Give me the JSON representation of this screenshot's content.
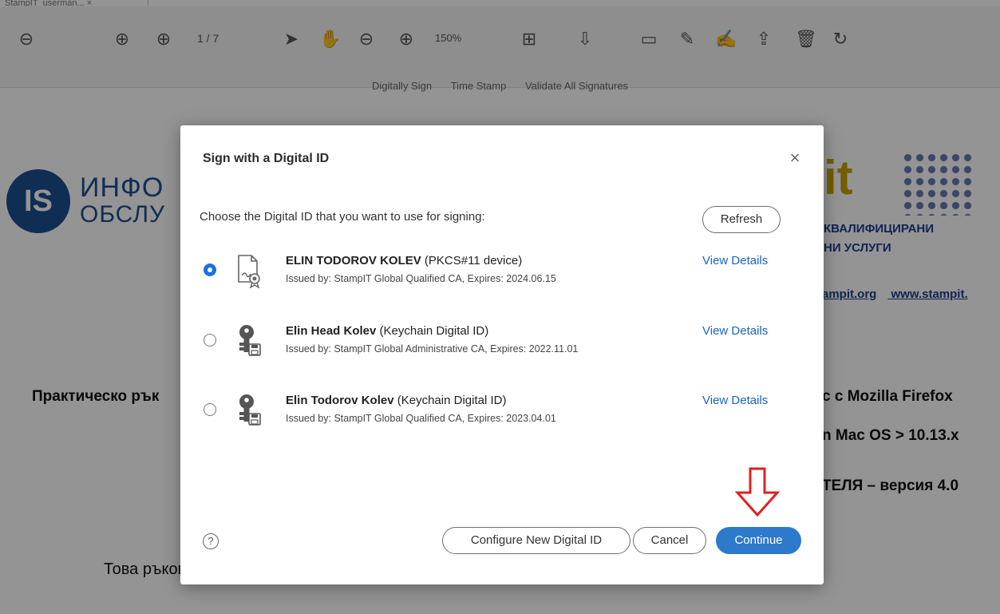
{
  "tab": {
    "label": "StampIT_userman... ×"
  },
  "toolbar": {
    "page_indicator": "1 / 7",
    "zoom_level": "150%",
    "sign_actions": [
      "Digitally Sign",
      "Time Stamp",
      "Validate All Signatures"
    ]
  },
  "document": {
    "logo_mark": "IS",
    "logo_line1": "ИНФО",
    "logo_line2": "ОБСЛУ",
    "brand_right": "it",
    "right_line1": "КВАЛИФИЦИРАНИ",
    "right_line2": "НИ УСЛУГИ",
    "right_links": [
      "ampit.org",
      "www.stampit."
    ],
    "heading_left": "Практическо рък",
    "heading_right_1": "с с Mozilla Firefox",
    "heading_right_2": "n Mac OS > 10.13.x",
    "heading_right_3": "ТЕЛЯ – версия 4.0",
    "paragraph": "Това ръководство е предназначено за потребители, притежаващи смарт карти, предоставени от"
  },
  "dialog": {
    "title": "Sign with a Digital ID",
    "close_glyph": "×",
    "prompt": "Choose the Digital ID that you want to use for signing:",
    "refresh_label": "Refresh",
    "view_details_label": "View Details",
    "ids": [
      {
        "name": "ELIN TODOROV KOLEV",
        "type": "(PKCS#11 device)",
        "issuer": "Issued by: StampIT Global Qualified CA, Expires: 2024.06.15",
        "selected": true,
        "icon": "certificate-icon"
      },
      {
        "name": "Elin Head Kolev",
        "type": "(Keychain Digital ID)",
        "issuer": "Issued by: StampIT Global Administrative CA, Expires: 2022.11.01",
        "selected": false,
        "icon": "key-icon"
      },
      {
        "name": "Elin Todorov Kolev",
        "type": "(Keychain Digital ID)",
        "issuer": "Issued by: StampIT Global Qualified CA, Expires: 2023.04.01",
        "selected": false,
        "icon": "key-icon"
      }
    ],
    "help_glyph": "?",
    "configure_label": "Configure New Digital ID",
    "cancel_label": "Cancel",
    "continue_label": "Continue"
  },
  "colors": {
    "accent": "#2d79cc",
    "link": "#1a64c4",
    "annotation_arrow": "#e02020"
  }
}
